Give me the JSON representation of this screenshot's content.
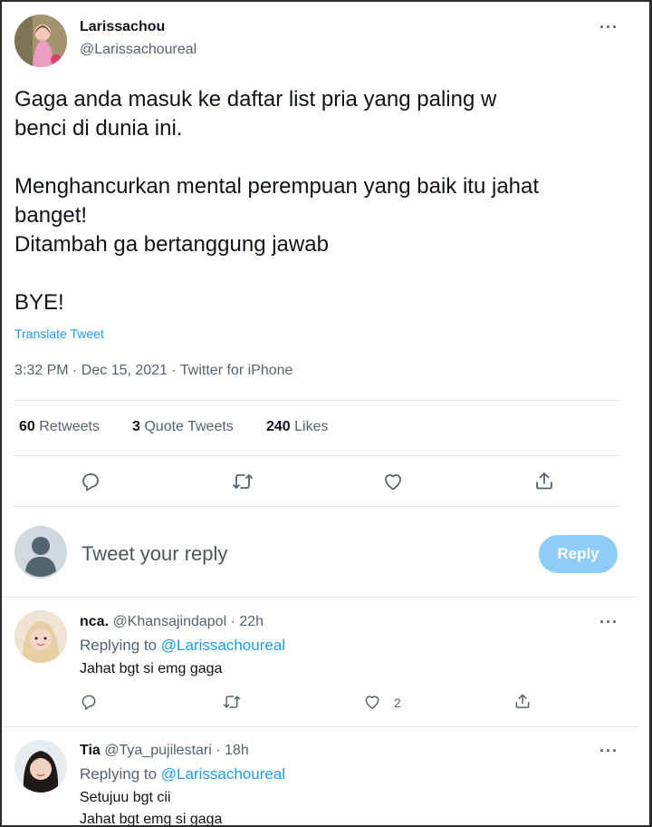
{
  "tweet": {
    "author_name": "Larissachou",
    "author_handle": "@Larissachoureal",
    "more_glyph": "···",
    "text": "Gaga anda masuk ke daftar list pria yang paling w\nbenci di dunia ini.\n\nMenghancurkan mental perempuan yang baik itu jahat\nbanget!\nDitambah ga bertanggung jawab\n\nBYE!",
    "translate_label": "Translate Tweet",
    "timestamp": "3:32 PM · Dec 15, 2021 · Twitter for iPhone",
    "stats": {
      "retweets_count": "60",
      "retweets_label": "Retweets",
      "quotes_count": "3",
      "quotes_label": "Quote Tweets",
      "likes_count": "240",
      "likes_label": "Likes"
    },
    "icons": [
      "reply-icon",
      "retweet-icon",
      "like-icon",
      "share-icon"
    ]
  },
  "compose": {
    "placeholder": "Tweet your reply",
    "reply_button_label": "Reply"
  },
  "replies": [
    {
      "name": "nca.",
      "handle": "@Khansajindapol",
      "separator": "·",
      "time": "22h",
      "replying_to_label": "Replying to",
      "replying_to_handle": "@Larissachoureal",
      "text": "Jahat bgt si emg gaga",
      "like_count": "2"
    },
    {
      "name": "Tia",
      "handle": "@Tya_pujilestari",
      "separator": "·",
      "time": "18h",
      "replying_to_label": "Replying to",
      "replying_to_handle": "@Larissachoureal",
      "text": "Setujuu bgt cii\nJahat bgt emg si gaga"
    }
  ],
  "colors": {
    "accent": "#1d9bf0",
    "reply_button": "#8ecdf7",
    "secondary_text": "#536471",
    "primary_text": "#0f1419"
  }
}
